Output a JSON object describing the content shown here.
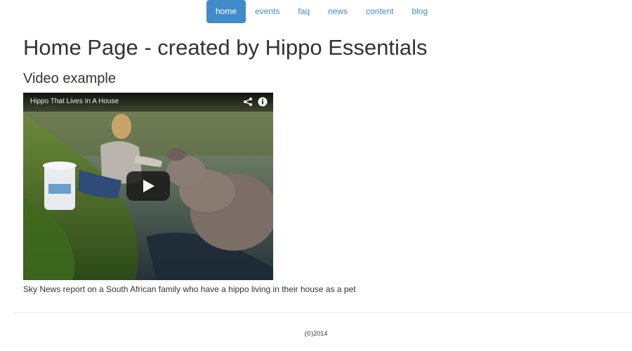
{
  "nav": {
    "items": [
      {
        "label": "home",
        "active": true
      },
      {
        "label": "events",
        "active": false
      },
      {
        "label": "faq",
        "active": false
      },
      {
        "label": "news",
        "active": false
      },
      {
        "label": "content",
        "active": false
      },
      {
        "label": "blog",
        "active": false
      }
    ]
  },
  "main": {
    "title": "Home Page - created by Hippo Essentials",
    "section_title": "Video example",
    "video": {
      "title": "Hippo That Lives In A House",
      "icons": [
        "share-icon",
        "info-icon",
        "play-icon"
      ]
    },
    "caption": "Sky News report on a South African family who have a hippo living in their house as a pet"
  },
  "footer": {
    "copyright": "(©)2014"
  },
  "colors": {
    "accent": "#428bca",
    "text": "#333333",
    "divider": "#e8e8e8"
  }
}
